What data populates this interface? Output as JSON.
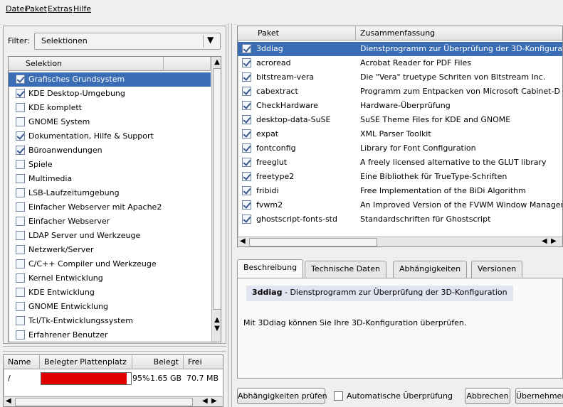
{
  "menu": {
    "datei": "Datei",
    "paket": "Paket",
    "extras": "Extras",
    "hilfe": "Hilfe"
  },
  "filter": {
    "label": "Filter:",
    "value": "Selektionen"
  },
  "selections": {
    "header": "Selektion",
    "items": [
      {
        "label": "Grafisches Grundsystem",
        "checked": true
      },
      {
        "label": "KDE Desktop-Umgebung",
        "checked": true
      },
      {
        "label": "KDE komplett",
        "checked": false
      },
      {
        "label": "GNOME System",
        "checked": false
      },
      {
        "label": "Dokumentation, Hilfe & Support",
        "checked": true
      },
      {
        "label": "Büroanwendungen",
        "checked": true
      },
      {
        "label": "Spiele",
        "checked": false
      },
      {
        "label": "Multimedia",
        "checked": false
      },
      {
        "label": "LSB-Laufzeitumgebung",
        "checked": false
      },
      {
        "label": "Einfacher Webserver mit Apache2",
        "checked": false
      },
      {
        "label": "Einfacher Webserver",
        "checked": false
      },
      {
        "label": "LDAP Server und Werkzeuge",
        "checked": false
      },
      {
        "label": "Netzwerk/Server",
        "checked": false
      },
      {
        "label": "C/C++ Compiler und Werkzeuge",
        "checked": false
      },
      {
        "label": "Kernel Entwicklung",
        "checked": false
      },
      {
        "label": "KDE Entwicklung",
        "checked": false
      },
      {
        "label": "GNOME Entwicklung",
        "checked": false
      },
      {
        "label": "Tcl/Tk-Entwicklungssystem",
        "checked": false
      },
      {
        "label": "Erfahrener Benutzer",
        "checked": false
      }
    ]
  },
  "disk": {
    "headers": {
      "name": "Name",
      "used_space": "Belegter Plattenplatz",
      "used": "Belegt",
      "free": "Frei"
    },
    "rows": [
      {
        "name": "/",
        "percent": "95%",
        "fill": 0.95,
        "used": "1.65 GB",
        "free": "70.7 MB"
      }
    ]
  },
  "packages": {
    "headers": {
      "paket": "Paket",
      "summary": "Zusammenfassung"
    },
    "rows": [
      {
        "name": "3ddiag",
        "summary": "Dienstprogramm zur Überprüfung der 3D-Konfigura"
      },
      {
        "name": "acroread",
        "summary": "Acrobat Reader for PDF Files"
      },
      {
        "name": "bitstream-vera",
        "summary": "Die \"Vera\" truetype Schriten von Bitstream Inc."
      },
      {
        "name": "cabextract",
        "summary": "Programm zum Entpacken von Microsoft Cabinet-D"
      },
      {
        "name": "CheckHardware",
        "summary": "Hardware-Überprüfung"
      },
      {
        "name": "desktop-data-SuSE",
        "summary": "SuSE Theme Files for KDE and GNOME"
      },
      {
        "name": "expat",
        "summary": "XML Parser Toolkit"
      },
      {
        "name": "fontconfig",
        "summary": "Library for Font Configuration"
      },
      {
        "name": "freeglut",
        "summary": "A freely licensed alternative to the GLUT library"
      },
      {
        "name": "freetype2",
        "summary": "Eine Bibliothek für TrueType-Schriften"
      },
      {
        "name": "fribidi",
        "summary": "Free Implementation of the BiDi Algorithm"
      },
      {
        "name": "fvwm2",
        "summary": "An Improved Version of the FVWM Window Manager"
      },
      {
        "name": "ghostscript-fonts-std",
        "summary": "Standardschriften für Ghostscript"
      }
    ]
  },
  "tabs": {
    "beschreibung": "Beschreibung",
    "technische_daten": "Technische Daten",
    "abhaengigkeiten": "Abhängigkeiten",
    "versionen": "Versionen"
  },
  "description": {
    "title": "3ddiag",
    "title_rest": " - Dienstprogramm zur Überprüfung der 3D-Konfiguration",
    "body": "Mit 3Ddiag können Sie Ihre 3D-Konfiguration überprüfen."
  },
  "buttons": {
    "check_deps": "Abhängigkeiten prüfen",
    "auto_check": "Automatische Überprüfung",
    "cancel": "Abbrechen",
    "accept": "Übernehmen"
  },
  "colors": {
    "selection": "#3b6db5",
    "disk_bar": "#e00000"
  }
}
